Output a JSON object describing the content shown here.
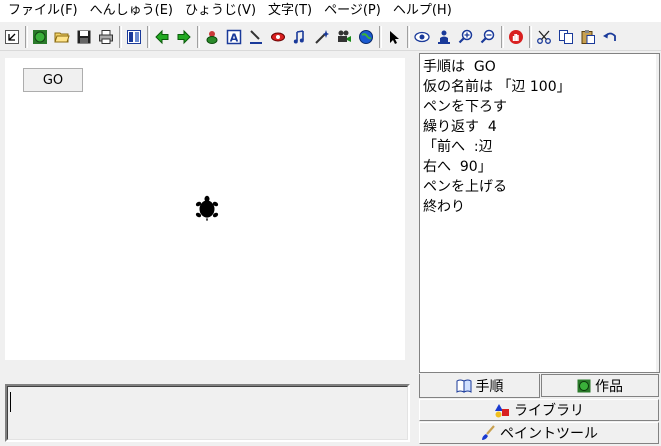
{
  "menu": [
    {
      "id": "file",
      "label": "ファイル(F)"
    },
    {
      "id": "edit",
      "label": "へんしゅう(E)"
    },
    {
      "id": "view",
      "label": "ひょうじ(V)"
    },
    {
      "id": "text",
      "label": "文字(T)"
    },
    {
      "id": "page",
      "label": "ページ(P)"
    },
    {
      "id": "help",
      "label": "ヘルプ(H)"
    }
  ],
  "canvas": {
    "go_label": "GO"
  },
  "program": {
    "lines": [
      "手順は  GO",
      "仮の名前は 「辺 100」",
      "ペンを下ろす",
      "繰り返す  4",
      "「前へ  :辺",
      "右へ  90」",
      "ペンを上げる",
      "終わり"
    ]
  },
  "tabs": {
    "procedures": "手順",
    "works": "作品"
  },
  "buttons": {
    "library": "ライブラリ",
    "paint_tool": "ペイントツール"
  },
  "colors": {
    "accent_green": "#1a9a1a",
    "arrow_green": "#22aa22",
    "stop_red": "#d92020"
  }
}
